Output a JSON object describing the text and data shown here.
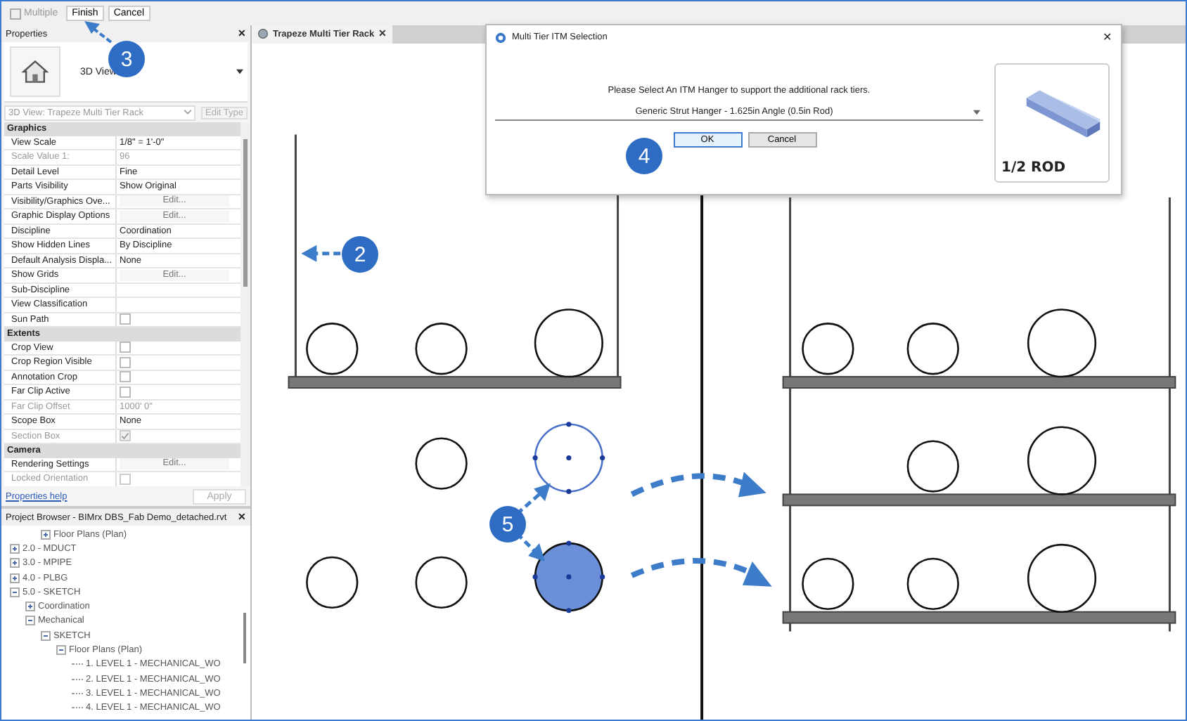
{
  "toolbar": {
    "multiple": {
      "label": "Multiple",
      "checked": false,
      "disabled": true
    },
    "buttons": [
      {
        "label": "Finish"
      },
      {
        "label": "Cancel"
      }
    ]
  },
  "properties": {
    "title": "Properties",
    "close": "✕",
    "type": "3D View",
    "view_selector": "3D View: Trapeze Multi Tier Rack",
    "edit_type": {
      "label": "Edit Type",
      "disabled": true
    },
    "groups": [
      {
        "name": "Graphics",
        "rows": [
          {
            "label": "View Scale",
            "kind": "text",
            "value": "1/8\" = 1'-0\"",
            "disabled": false
          },
          {
            "label": "Scale Value    1:",
            "kind": "text",
            "value": "96",
            "disabled": true
          },
          {
            "label": "Detail Level",
            "kind": "text",
            "value": "Fine",
            "disabled": false
          },
          {
            "label": "Parts Visibility",
            "kind": "text",
            "value": "Show Original",
            "disabled": false
          },
          {
            "label": "Visibility/Graphics Ove...",
            "kind": "button",
            "value": "Edit...",
            "disabled": false
          },
          {
            "label": "Graphic Display Options",
            "kind": "button",
            "value": "Edit...",
            "disabled": false
          },
          {
            "label": "Discipline",
            "kind": "text",
            "value": "Coordination",
            "disabled": false
          },
          {
            "label": "Show Hidden Lines",
            "kind": "text",
            "value": "By Discipline",
            "disabled": false
          },
          {
            "label": "Default Analysis Displa...",
            "kind": "text",
            "value": "None",
            "disabled": false
          },
          {
            "label": "Show Grids",
            "kind": "button",
            "value": "Edit...",
            "disabled": false
          },
          {
            "label": "Sub-Discipline",
            "kind": "empty",
            "disabled": false
          },
          {
            "label": "View Classification",
            "kind": "empty",
            "disabled": false
          },
          {
            "label": "Sun Path",
            "kind": "checkbox",
            "checked": false,
            "disabled": false
          }
        ]
      },
      {
        "name": "Extents",
        "rows": [
          {
            "label": "Crop View",
            "kind": "checkbox",
            "checked": false,
            "disabled": false
          },
          {
            "label": "Crop Region Visible",
            "kind": "checkbox",
            "checked": false,
            "disabled": false
          },
          {
            "label": "Annotation Crop",
            "kind": "checkbox",
            "checked": false,
            "disabled": false
          },
          {
            "label": "Far Clip Active",
            "kind": "checkbox",
            "checked": false,
            "disabled": false
          },
          {
            "label": "Far Clip Offset",
            "kind": "text",
            "value": "1000'  0\"",
            "disabled": true
          },
          {
            "label": "Scope Box",
            "kind": "text",
            "value": "None",
            "disabled": false
          },
          {
            "label": "Section Box",
            "kind": "checkbox",
            "checked": true,
            "disabled": true
          }
        ]
      },
      {
        "name": "Camera",
        "rows": [
          {
            "label": "Rendering Settings",
            "kind": "button",
            "value": "Edit...",
            "disabled": false
          },
          {
            "label": "Locked Orientation",
            "kind": "checkbox",
            "checked": false,
            "disabled": true
          }
        ]
      }
    ],
    "help": "Properties help",
    "apply": {
      "label": "Apply",
      "disabled": true
    }
  },
  "browser": {
    "title": "Project Browser - BIMrx DBS_Fab Demo_detached.rvt",
    "close": "✕",
    "tree": [
      {
        "label": "Floor Plans (Plan)",
        "kind": "continued",
        "expanded": false
      },
      {
        "label": "2.0 - MDUCT",
        "expanded": false
      },
      {
        "label": "3.0 - MPIPE",
        "expanded": false
      },
      {
        "label": "4.0 - PLBG",
        "expanded": false
      },
      {
        "label": "5.0 - SKETCH",
        "expanded": true,
        "children": [
          {
            "label": "Coordination",
            "expanded": false
          },
          {
            "label": "Mechanical",
            "expanded": true,
            "children": [
              {
                "label": "SKETCH",
                "expanded": true,
                "children": [
                  {
                    "label": "Floor Plans (Plan)",
                    "expanded": true,
                    "children": [
                      {
                        "label": "1. LEVEL 1 - MECHANICAL_WO"
                      },
                      {
                        "label": "2. LEVEL 1 - MECHANICAL_WO"
                      },
                      {
                        "label": "3. LEVEL 1 - MECHANICAL_WO"
                      },
                      {
                        "label": "4. LEVEL 1 - MECHANICAL_WO"
                      }
                    ]
                  }
                ]
              }
            ]
          }
        ]
      }
    ]
  },
  "view_tab": {
    "label": "Trapeze Multi Tier Rack",
    "close": "✕"
  },
  "dialog": {
    "title": "Multi Tier ITM Selection",
    "close": "✕",
    "prompt": "Please Select An ITM Hanger to support the additional rack tiers.",
    "hanger": "Generic Strut Hanger - 1.625in Angle (0.5in Rod)",
    "buttons": [
      {
        "label": "OK",
        "selected": true
      },
      {
        "label": "Cancel",
        "selected": false
      }
    ],
    "preview_label": "1/2 ROD"
  },
  "badges": [
    {
      "label": "3"
    },
    {
      "label": "4"
    },
    {
      "label": "2"
    },
    {
      "label": "5"
    }
  ]
}
